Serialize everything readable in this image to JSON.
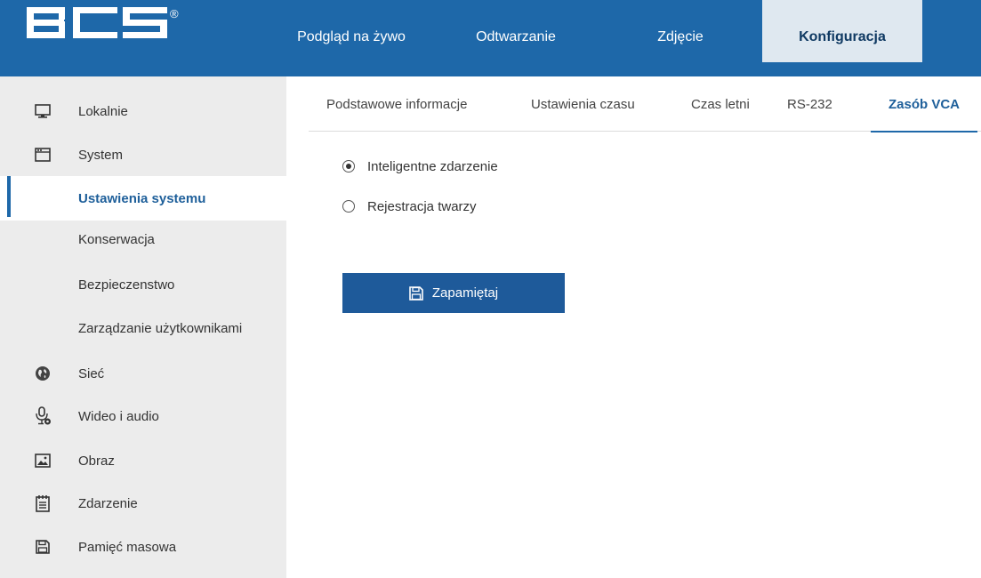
{
  "brand": {
    "logo_text": "BCS",
    "registered_mark": "®"
  },
  "top_nav": [
    {
      "label": "Podgląd na żywo"
    },
    {
      "label": "Odtwarzanie"
    },
    {
      "label": "Zdjęcie"
    },
    {
      "label": "Konfiguracja",
      "active": true
    }
  ],
  "sidebar": {
    "items": [
      {
        "label": "Lokalnie",
        "icon": "monitor-icon"
      },
      {
        "label": "System",
        "icon": "window-icon"
      },
      {
        "label": "Ustawienia systemu",
        "active": true
      },
      {
        "label": "Konserwacja"
      },
      {
        "label": "Bezpieczenstwo"
      },
      {
        "label": "Zarządzanie użytkownikami"
      },
      {
        "label": "Sieć",
        "icon": "globe-icon"
      },
      {
        "label": "Wideo i audio",
        "icon": "microphone-icon"
      },
      {
        "label": "Obraz",
        "icon": "image-icon"
      },
      {
        "label": "Zdarzenie",
        "icon": "calendar-icon"
      },
      {
        "label": "Pamięć masowa",
        "icon": "storage-icon"
      }
    ]
  },
  "tabs": [
    {
      "label": "Podstawowe informacje"
    },
    {
      "label": "Ustawienia czasu"
    },
    {
      "label": "Czas letni"
    },
    {
      "label": "RS-232"
    },
    {
      "label": "Zasób VCA",
      "active": true
    }
  ],
  "vca_options": [
    {
      "label": "Inteligentne zdarzenie",
      "checked": true
    },
    {
      "label": "Rejestracja twarzy",
      "checked": false
    }
  ],
  "save_button": {
    "label": "Zapamiętaj",
    "icon": "floppy-disk-icon"
  },
  "colors": {
    "header": "#1e68a9",
    "accent": "#1e5f9a",
    "sidebar_bg": "#ececec",
    "active_nav_bg": "#dfe8f0"
  }
}
